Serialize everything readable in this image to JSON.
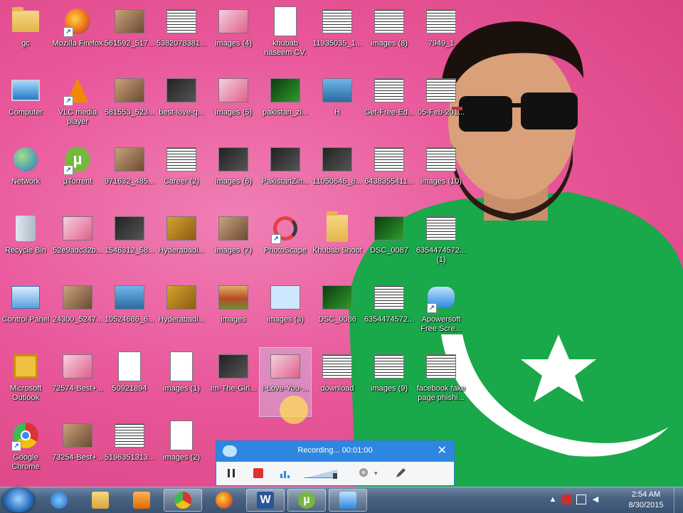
{
  "desktop": {
    "icons": [
      {
        "label": "gc"
      },
      {
        "label": "Mozilla Firefox"
      },
      {
        "label": "561592_517..."
      },
      {
        "label": "5382078381..."
      },
      {
        "label": "images (4)"
      },
      {
        "label": "khubab naseem CV."
      },
      {
        "label": "11935035_1..."
      },
      {
        "label": "images (8)"
      },
      {
        "label": "7949_1"
      },
      {
        "label": "Computer"
      },
      {
        "label": "VLC media player"
      },
      {
        "label": "581553_523..."
      },
      {
        "label": "best-love-q..."
      },
      {
        "label": "images (5)"
      },
      {
        "label": "pakistan_zi..."
      },
      {
        "label": "H"
      },
      {
        "label": "Get-Free-Ed..."
      },
      {
        "label": "05-Feb-201..."
      },
      {
        "label": "Network"
      },
      {
        "label": "µTorrent"
      },
      {
        "label": "971632_485..."
      },
      {
        "label": "Career (2)"
      },
      {
        "label": "images (6)"
      },
      {
        "label": "PakistanZin..."
      },
      {
        "label": "11050646_8..."
      },
      {
        "label": "6438355411..."
      },
      {
        "label": "images (10)"
      },
      {
        "label": "Recycle Bin"
      },
      {
        "label": "52e9adc32b..."
      },
      {
        "label": "1546312_58..."
      },
      {
        "label": "Hyderabadi..."
      },
      {
        "label": "images (7)"
      },
      {
        "label": "PhotoScape"
      },
      {
        "label": "Khubab Shoot"
      },
      {
        "label": "DSC_0087"
      },
      {
        "label": "6354474572... (1)"
      },
      {
        "label": "Control Panel"
      },
      {
        "label": "24300_5247..."
      },
      {
        "label": "10524686_6..."
      },
      {
        "label": "Hyderabadi..."
      },
      {
        "label": "images"
      },
      {
        "label": "images (3)"
      },
      {
        "label": "DSC_0086"
      },
      {
        "label": "6354474572..."
      },
      {
        "label": "Apowersoft Free Scre..."
      },
      {
        "label": "Microsoft Outlook"
      },
      {
        "label": "72574-Best+..."
      },
      {
        "label": "50921894"
      },
      {
        "label": "images (1)"
      },
      {
        "label": "Im-The-Girl..."
      },
      {
        "label": "I-Love-You-..."
      },
      {
        "label": "download"
      },
      {
        "label": "images (9)"
      },
      {
        "label": "facebook fake page phishi..."
      },
      {
        "label": "Google Chrome"
      },
      {
        "label": "73254-Best+..."
      },
      {
        "label": "5196351313..."
      },
      {
        "label": "images (2)"
      }
    ]
  },
  "recorder": {
    "status": "Recording... 00:01:00"
  },
  "taskbar": {
    "clock_time": "2:54 AM",
    "clock_date": "8/30/2015"
  },
  "colors": {
    "wallpaper": "#e9589b",
    "taskbar": "#4a6383",
    "recorder_titlebar": "#2d87e0"
  }
}
